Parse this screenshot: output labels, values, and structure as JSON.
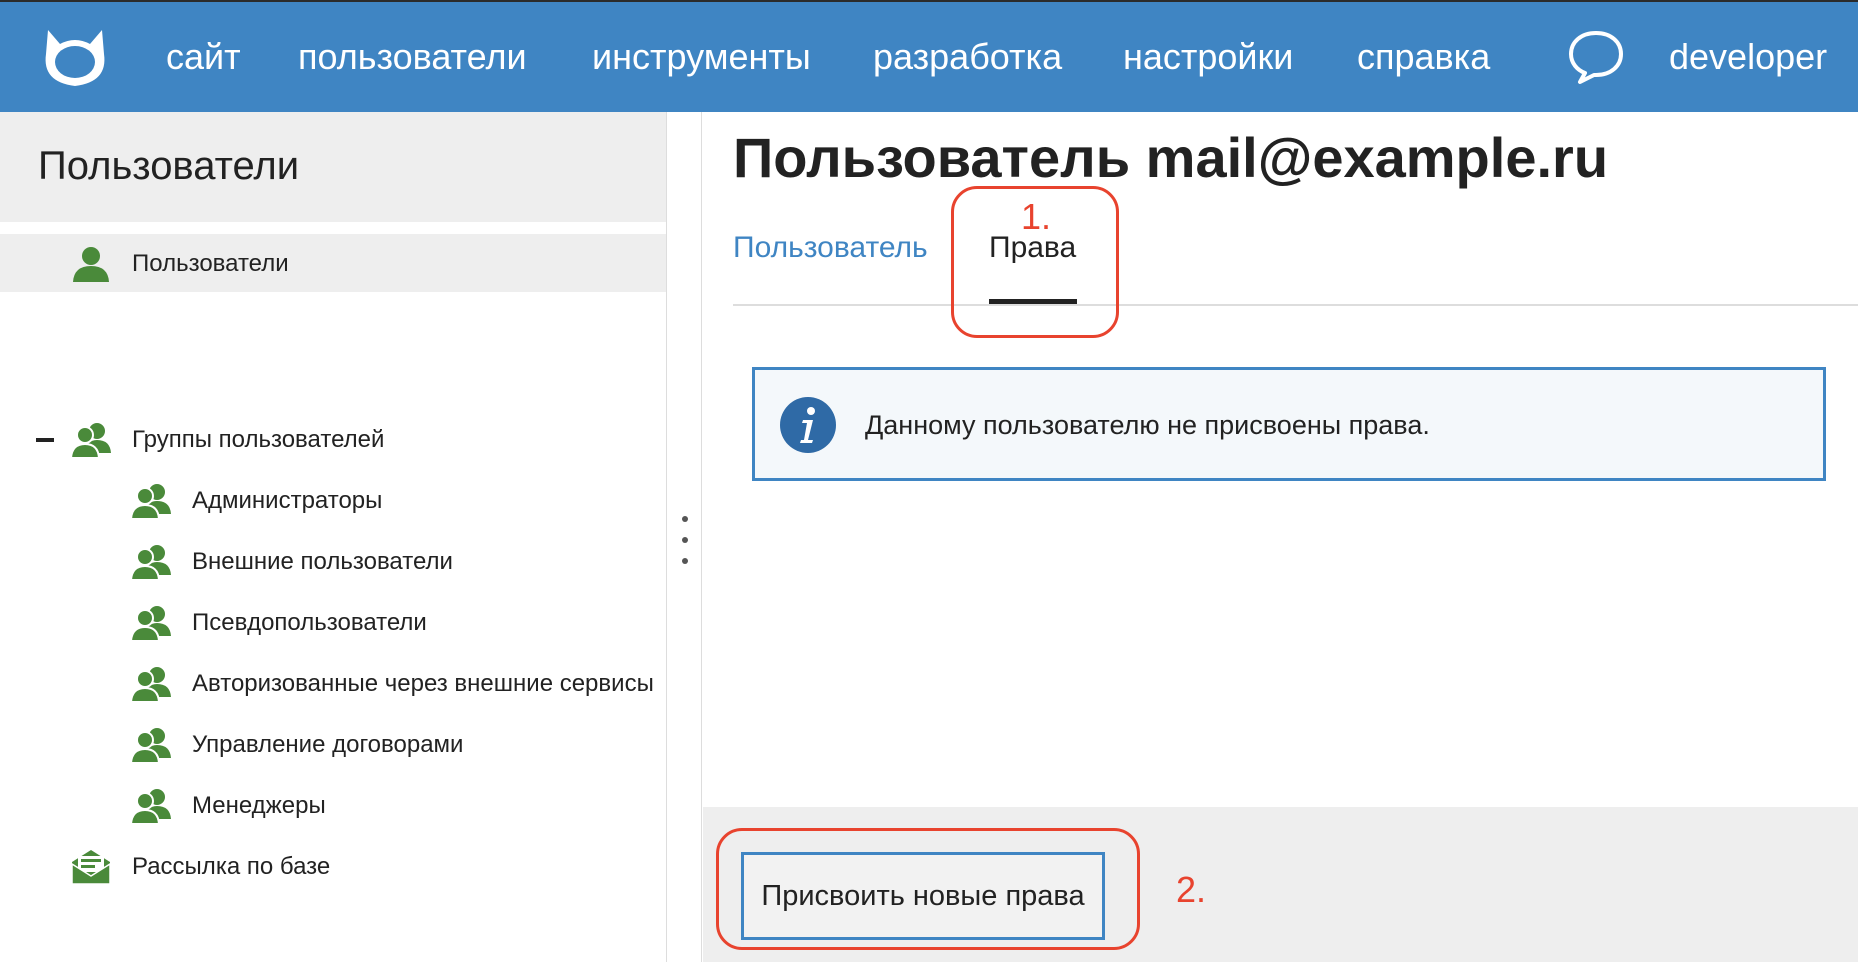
{
  "header": {
    "nav": [
      "сайт",
      "пользователи",
      "инструменты",
      "разработка",
      "настройки",
      "справка"
    ],
    "user": "developer",
    "icons": {
      "logo": "cat-logo-icon",
      "chat": "chat-bubble-icon"
    }
  },
  "sidebar": {
    "title": "Пользователи",
    "tree": [
      {
        "label": "Пользователи",
        "icon": "user-icon",
        "selected": true
      },
      {
        "label": "Группы пользователей",
        "icon": "users-group-icon",
        "expanded": true
      },
      {
        "label": "Администраторы",
        "icon": "users-group-icon"
      },
      {
        "label": "Внешние пользователи",
        "icon": "users-group-icon"
      },
      {
        "label": "Псевдопользователи",
        "icon": "users-group-icon"
      },
      {
        "label": "Авторизованные через внешние сервисы",
        "icon": "users-group-icon"
      },
      {
        "label": "Управление договорами",
        "icon": "users-group-icon"
      },
      {
        "label": "Менеджеры",
        "icon": "users-group-icon"
      },
      {
        "label": "Рассылка по базе",
        "icon": "mail-icon"
      }
    ]
  },
  "main": {
    "title": "Пользователь mail@example.ru",
    "tabs": [
      {
        "label": "Пользователь",
        "active": false
      },
      {
        "label": "Права",
        "active": true
      }
    ],
    "info_message": "Данному пользователю не присвоены права.",
    "assign_button": "Присвоить новые права"
  },
  "annotations": [
    "1.",
    "2."
  ],
  "colors": {
    "header_bg": "#3f85c3",
    "accent": "#3f85c3",
    "icon_green": "#4a8a3a",
    "annotation_red": "#e8432e",
    "panel_gray": "#eeeeee"
  }
}
